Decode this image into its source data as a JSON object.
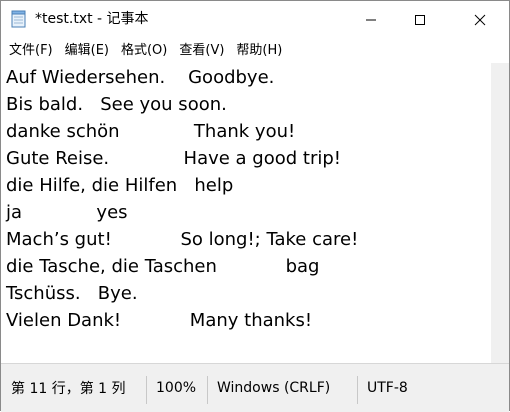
{
  "window": {
    "title": "*test.txt - 记事本"
  },
  "menu": {
    "items": [
      "文件(F)",
      "编辑(E)",
      "格式(O)",
      "查看(V)",
      "帮助(H)"
    ]
  },
  "editor": {
    "lines": [
      "Auf Wiedersehen.    Goodbye.",
      "Bis bald.   See you soon.",
      "danke schön             Thank you!",
      "Gute Reise.             Have a good trip!",
      "die Hilfe, die Hilfen   help",
      "ja             yes",
      "Mach’s gut!            So long!; Take care!",
      "die Tasche, die Taschen            bag",
      "Tschüss.   Bye.",
      "Vielen Dank!            Many thanks!"
    ]
  },
  "status": {
    "position": "第 11 行，第 1 列",
    "zoom": "100%",
    "line_ending": "Windows (CRLF)",
    "encoding": "UTF-8"
  },
  "icons": {
    "app": "notepad-icon",
    "minimize": "minimize-icon",
    "maximize": "maximize-icon",
    "close": "close-icon"
  }
}
